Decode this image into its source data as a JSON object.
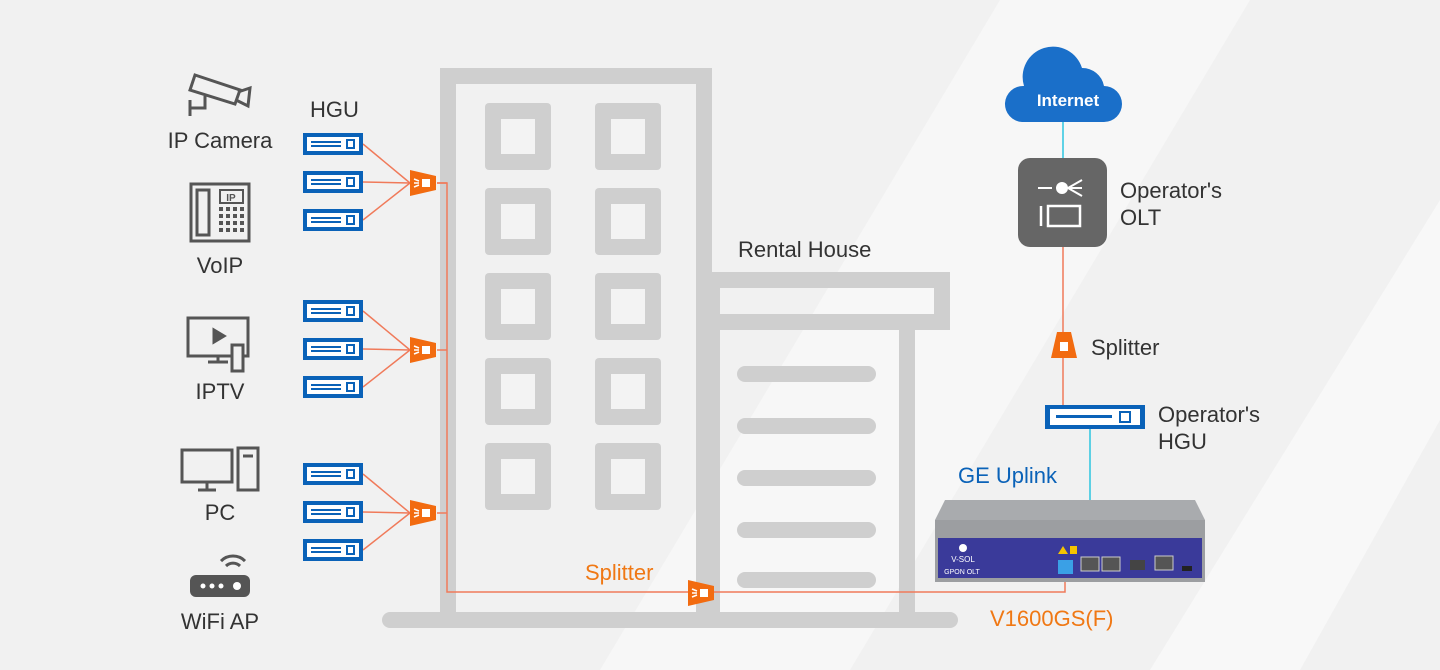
{
  "devices": [
    {
      "label": "IP Camera",
      "icon": "camera-icon"
    },
    {
      "label": "VoIP",
      "icon": "ip-phone-icon",
      "badge": "IP"
    },
    {
      "label": "IPTV",
      "icon": "tv-icon"
    },
    {
      "label": "PC",
      "icon": "pc-icon"
    },
    {
      "label": "WiFi AP",
      "icon": "wifi-router-icon"
    }
  ],
  "hgu_label": "HGU",
  "rental_house_label": "Rental House",
  "splitter_label": "Splitter",
  "internet_label": "Internet",
  "olt_label": [
    "Operator's",
    "OLT"
  ],
  "operator_splitter_label": "Splitter",
  "operator_hgu_label": [
    "Operator's",
    "HGU"
  ],
  "uplink_label": "GE Uplink",
  "product_label": "V1600GS(F)",
  "device_brand": "V-SOL",
  "device_model_text": "GPON OLT",
  "colors": {
    "hgu_blue": "#0a62b8",
    "splitter_orange": "#f26b10",
    "fiber_line": "#f07a5a",
    "uplink_line": "#2cc6e0",
    "building_grey": "#cfcfcf",
    "accent_orange": "#f07814",
    "accent_blue": "#0a62b8",
    "olt_grey": "#666666",
    "device_panel": "#3a3a9a"
  }
}
